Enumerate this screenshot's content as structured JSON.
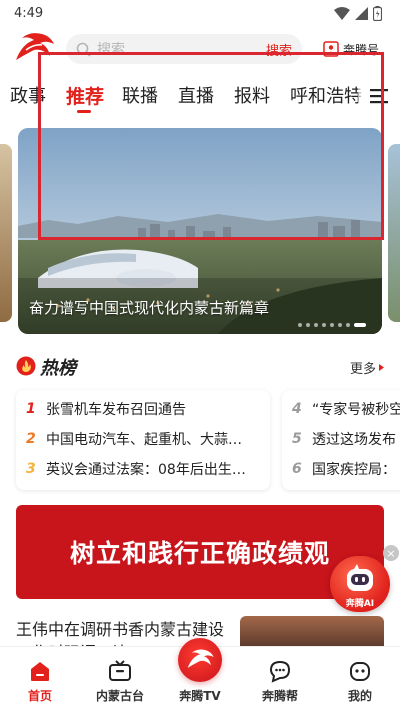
{
  "status_bar": {
    "time": "4:49"
  },
  "header": {
    "search_placeholder": "搜索",
    "search_button": "搜索",
    "benteng_label": "奔腾号"
  },
  "channels": [
    {
      "label": "政事"
    },
    {
      "label": "推荐",
      "active": true
    },
    {
      "label": "联播"
    },
    {
      "label": "直播"
    },
    {
      "label": "报料"
    },
    {
      "label": "呼和浩特"
    }
  ],
  "banner": {
    "caption": "奋力谱写中国式现代化内蒙古新篇章",
    "slide_count": 8,
    "active_slide": 8
  },
  "hot": {
    "title": "热榜",
    "more": "更多",
    "items": [
      {
        "rank": "1",
        "text": "张雪机车发布召回通告"
      },
      {
        "rank": "2",
        "text": "中国电动汽车、起重机、大蒜…"
      },
      {
        "rank": "3",
        "text": "英议会通过法案：08年后出生…"
      },
      {
        "rank": "4",
        "text": "“专家号被秒空"
      },
      {
        "rank": "5",
        "text": "透过这场发布"
      },
      {
        "rank": "6",
        "text": "国家疾控局："
      }
    ]
  },
  "ad": {
    "text": "树立和践行正确政绩观",
    "close": "×"
  },
  "ai_bubble": {
    "label": "奔腾AI"
  },
  "news": {
    "title": "王伟中在调研书香内蒙古建设工作时强调：让"
  },
  "bottom_nav": [
    {
      "label": "首页",
      "icon": "home-icon",
      "active": true
    },
    {
      "label": "内蒙古台",
      "icon": "tv-icon"
    },
    {
      "label": "奔腾TV",
      "icon": "horse-logo-icon"
    },
    {
      "label": "奔腾帮",
      "icon": "chat-icon"
    },
    {
      "label": "我的",
      "icon": "profile-icon"
    }
  ],
  "colors": {
    "accent": "#e2211c",
    "ad_red": "#c8141b",
    "highlight": "#d9262f"
  }
}
